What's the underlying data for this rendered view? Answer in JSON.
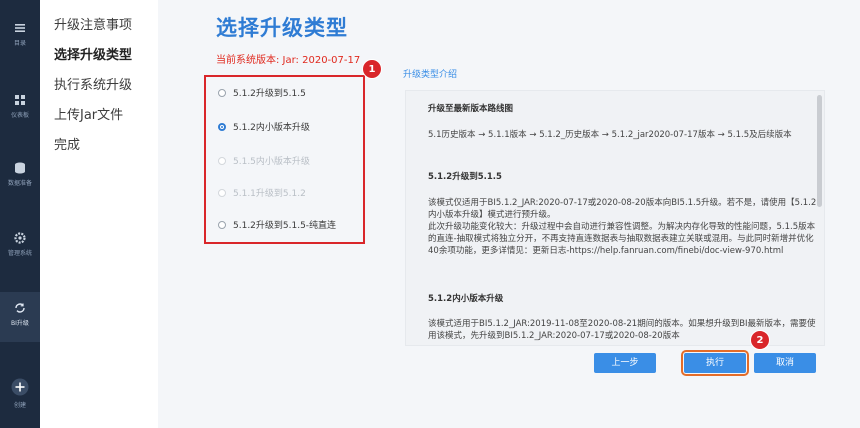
{
  "nav": [
    {
      "label": "目录",
      "icon": "menu-icon"
    },
    {
      "label": "仪表板",
      "icon": "dashboard-icon"
    },
    {
      "label": "数据准备",
      "icon": "database-icon"
    },
    {
      "label": "管理系统",
      "icon": "gear-icon"
    },
    {
      "label": "BI升级",
      "icon": "upgrade-icon"
    },
    {
      "label": "创建",
      "icon": "plus-icon"
    }
  ],
  "steps": [
    "升级注意事项",
    "选择升级类型",
    "执行系统升级",
    "上传Jar文件",
    "完成"
  ],
  "title": "选择升级类型",
  "current_version": "当前系统版本:  Jar: 2020-07-17",
  "intro_link": "升级类型介绍",
  "options": [
    {
      "label": "5.1.2升级到5.1.5",
      "state": "enabled",
      "checked": false
    },
    {
      "label": "5.1.2内小版本升级",
      "state": "enabled",
      "checked": true
    },
    {
      "label": "5.1.5内小版本升级",
      "state": "disabled",
      "checked": false
    },
    {
      "label": "5.1.1升级到5.1.2",
      "state": "disabled",
      "checked": false
    },
    {
      "label": "5.1.2升级到5.1.5-纯直连",
      "state": "enabled",
      "checked": false
    }
  ],
  "badges": [
    "1",
    "2"
  ],
  "intro": {
    "h1": "升级至最新版本路线图",
    "route": "5.1历史版本 → 5.1.1版本 → 5.1.2_历史版本 → 5.1.2_jar2020-07-17版本 → 5.1.5及后续版本",
    "h2": "5.1.2升级到5.1.5",
    "p2": "该模式仅适用于BI5.1.2_JAR:2020-07-17或2020-08-20版本向BI5.1.5升级。若不是，请使用【5.1.2内小版本升级】模式进行预升级。",
    "p3": "此次升级功能变化较大：升级过程中会自动进行兼容性调整。为解决内存化导致的性能问题，5.1.5版本的直连-抽取模式将独立分开，不再支持直连数据表与抽取数据表建立关联或混用。与此同时新增并优化40余项功能，更多详情见：更新日志-https://help.fanruan.com/finebi/doc-view-970.html",
    "h3": "5.1.2内小版本升级",
    "p4": "该模式适用于BI5.1.2_JAR:2019-11-08至2020-08-21期间的版本。如果想升级到BI最新版本，需要使用该模式，先升级到BI5.1.2_JAR:2020-07-17或2020-08-20版本"
  },
  "buttons": {
    "prev": "上一步",
    "exec": "执行",
    "cancel": "取消"
  }
}
